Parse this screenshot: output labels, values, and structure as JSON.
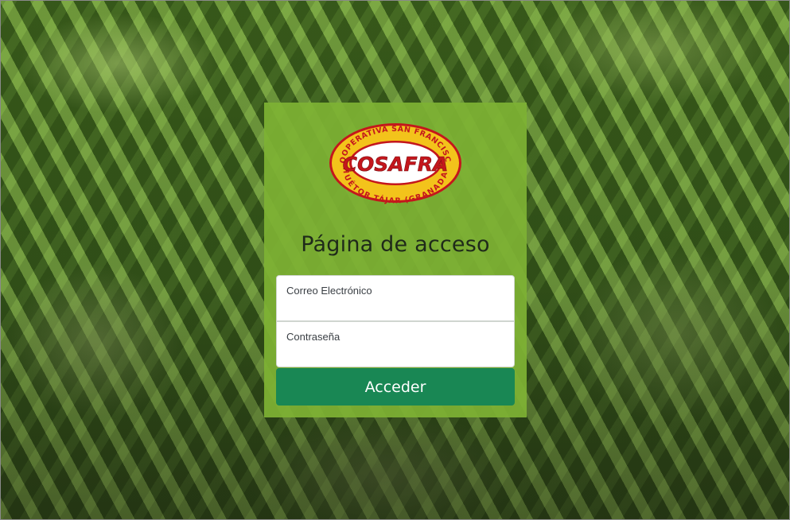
{
  "logo": {
    "top_text": "COOPERATIVA SAN FRANCISCO",
    "brand": "COSAFRA",
    "bottom_text": "HUÉTOR TÁJAR (GRANADA)",
    "colors": {
      "ring": "#f3c31b",
      "outline": "#c4161c",
      "center": "#ffffff",
      "brand_text": "#c4161c"
    }
  },
  "login": {
    "title": "Página de acceso",
    "email_label": "Correo Electrónico",
    "email_value": "",
    "password_label": "Contraseña",
    "password_value": "",
    "submit_label": "Acceder"
  },
  "colors": {
    "card": "#7eb234",
    "button": "#198754"
  }
}
